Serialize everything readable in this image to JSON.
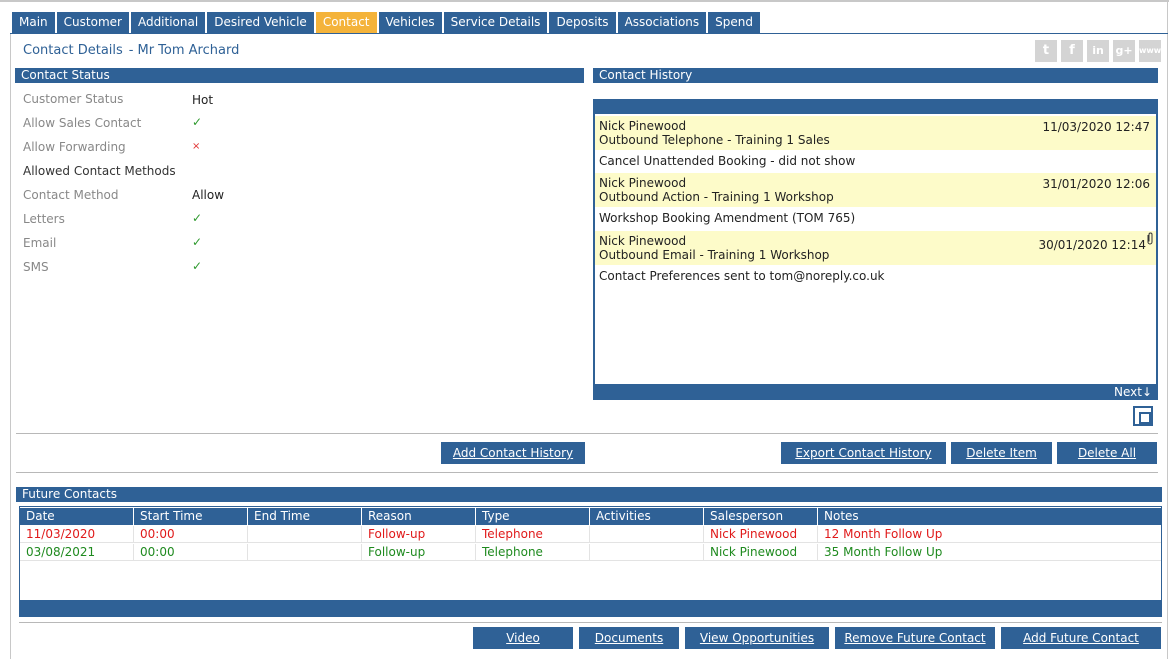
{
  "tabs": [
    "Main",
    "Customer",
    "Additional",
    "Desired Vehicle",
    "Contact",
    "Vehicles",
    "Service Details",
    "Deposits",
    "Associations",
    "Spend"
  ],
  "title": {
    "section": "Contact Details",
    "separator": "-",
    "customer": "Mr Tom Archard"
  },
  "social_icons": [
    "twitter-icon",
    "facebook-icon",
    "linkedin-icon",
    "google-plus-icon",
    "www-icon"
  ],
  "social_glyphs": {
    "twitter": "t",
    "facebook": "f",
    "linkedin": "in",
    "google": "g+",
    "www": "www"
  },
  "contact_status": {
    "header": "Contact Status",
    "rows": {
      "customer_status": {
        "label": "Customer Status",
        "value": "Hot"
      },
      "allow_sales_contact": {
        "label": "Allow Sales Contact",
        "value": "✓"
      },
      "allow_forwarding": {
        "label": "Allow Forwarding",
        "value": "×"
      },
      "allowed_methods": {
        "label": "Allowed Contact Methods"
      },
      "contact_method": {
        "label": "Contact Method",
        "value": "Allow"
      },
      "letters": {
        "label": "Letters",
        "value": "✓"
      },
      "email": {
        "label": "Email",
        "value": "✓"
      },
      "sms": {
        "label": "SMS",
        "value": "✓"
      }
    }
  },
  "contact_history": {
    "header": "Contact History",
    "entries": [
      {
        "person": "Nick Pinewood",
        "action": "Outbound Telephone - Training 1 Sales",
        "date": "11/03/2020 12:47",
        "note": "Cancel Unattended Booking - did not show"
      },
      {
        "person": "Nick Pinewood",
        "action": "Outbound Action - Training 1 Workshop",
        "date": "31/01/2020 12:06",
        "note": "Workshop Booking Amendment (TOM 765)"
      },
      {
        "person": "Nick Pinewood",
        "action": "Outbound Email - Training 1 Workshop",
        "date": "30/01/2020 12:14",
        "note": "Contact Preferences sent to tom@noreply.co.uk"
      }
    ],
    "next_label": "Next↓"
  },
  "buttons": {
    "add_contact_history": "Add Contact History",
    "export_contact_history": "Export Contact History",
    "delete_item": "Delete Item",
    "delete_all": "Delete All",
    "video": "Video",
    "documents": "Documents",
    "view_opportunities": "View Opportunities",
    "remove_future_contact": "Remove Future Contact",
    "add_future_contact": "Add Future Contact"
  },
  "future_contacts": {
    "header": "Future Contacts",
    "columns": [
      "Date",
      "Start Time",
      "End Time",
      "Reason",
      "Type",
      "Activities",
      "Salesperson",
      "Notes"
    ],
    "rows": [
      {
        "status": "red",
        "cells": [
          "11/03/2020",
          "00:00",
          "",
          "Follow-up",
          "Telephone",
          "",
          "Nick Pinewood",
          "12 Month Follow Up"
        ]
      },
      {
        "status": "green",
        "cells": [
          "03/08/2021",
          "00:00",
          "",
          "Follow-up",
          "Telephone",
          "",
          "Nick Pinewood",
          "35 Month Follow Up"
        ]
      }
    ]
  },
  "colors": {
    "accent": "#2f6196",
    "active_tab": "#f4b33a",
    "history_highlight": "#fdfbc9",
    "overdue": "#e01a1a",
    "upcoming": "#1f8a1f"
  }
}
